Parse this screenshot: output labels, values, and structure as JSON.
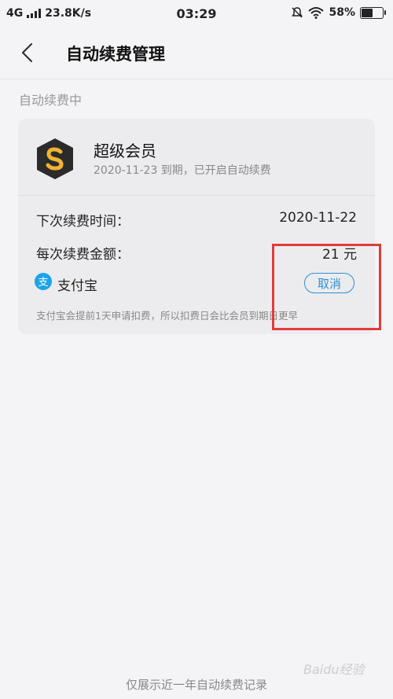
{
  "statusbar": {
    "network": "4G",
    "speed": "23.8K/s",
    "time": "03:29",
    "battery": "58%",
    "battery_fraction": 0.58
  },
  "header": {
    "title": "自动续费管理"
  },
  "section": {
    "title": "自动续费中"
  },
  "subscription": {
    "name": "超级会员",
    "subtitle": "2020-11-23 到期，已开启自动续费",
    "next_label": "下次续费时间：",
    "next_value": "2020-11-22",
    "amount_label": "每次续费金额：",
    "amount_value": "21 元",
    "payment_method": "支付宝",
    "cancel_label": "取消",
    "note": "支付宝会提前1天申请扣费，所以扣费日会比会员到期日更早",
    "pay_icon_glyph": "支"
  },
  "footer": {
    "note": "仅展示近一年自动续费记录"
  },
  "watermark": "Baidu经验",
  "colors": {
    "accent": "#2d8fd5",
    "highlight": "#e23b3b",
    "alipay": "#1aa3e8",
    "logo_bg": "#2b2b2b",
    "logo_fg": "#f2b233"
  }
}
